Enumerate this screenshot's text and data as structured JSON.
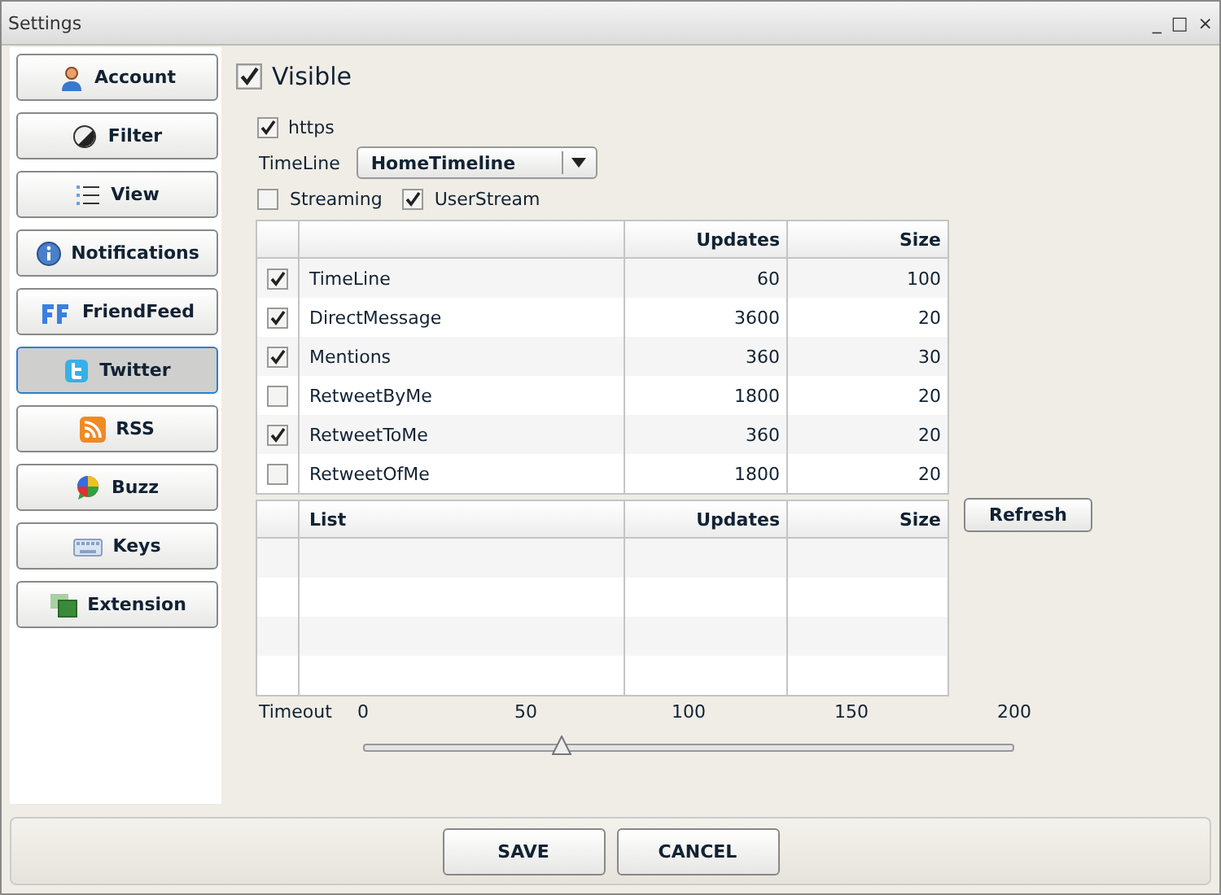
{
  "window": {
    "title": "Settings",
    "controls": [
      "_",
      "□",
      "×"
    ]
  },
  "sidebar": {
    "items": [
      {
        "label": "Account",
        "selected": false
      },
      {
        "label": "Filter",
        "selected": false
      },
      {
        "label": "View",
        "selected": false
      },
      {
        "label": "Notifications",
        "selected": false
      },
      {
        "label": "FriendFeed",
        "selected": false
      },
      {
        "label": "Twitter",
        "selected": true
      },
      {
        "label": "RSS",
        "selected": false
      },
      {
        "label": "Buzz",
        "selected": false
      },
      {
        "label": "Keys",
        "selected": false
      },
      {
        "label": "Extension",
        "selected": false
      }
    ]
  },
  "visible": {
    "label": "Visible",
    "checked": true
  },
  "https": {
    "label": "https",
    "checked": true
  },
  "timeline": {
    "label": "TimeLine",
    "value": "HomeTimeline"
  },
  "streams": [
    {
      "label": "Streaming",
      "checked": false
    },
    {
      "label": "UserStream",
      "checked": true
    }
  ],
  "table": {
    "columns": [
      "Updates",
      "Size"
    ],
    "rows": [
      {
        "checked": true,
        "name": "TimeLine",
        "updates": "60",
        "size": "100"
      },
      {
        "checked": true,
        "name": "DirectMessage",
        "updates": "3600",
        "size": "20"
      },
      {
        "checked": true,
        "name": "Mentions",
        "updates": "360",
        "size": "30"
      },
      {
        "checked": false,
        "name": "RetweetByMe",
        "updates": "1800",
        "size": "20"
      },
      {
        "checked": true,
        "name": "RetweetToMe",
        "updates": "360",
        "size": "20"
      },
      {
        "checked": false,
        "name": "RetweetOfMe",
        "updates": "1800",
        "size": "20"
      }
    ]
  },
  "list_table": {
    "columns": [
      "List",
      "Updates",
      "Size"
    ]
  },
  "refresh_button": "Refresh",
  "timeout": {
    "label": "Timeout",
    "ticks": [
      "0",
      "50",
      "100",
      "150",
      "200"
    ],
    "level": 0.3
  },
  "buttons": [
    "SAVE",
    "CANCEL"
  ]
}
